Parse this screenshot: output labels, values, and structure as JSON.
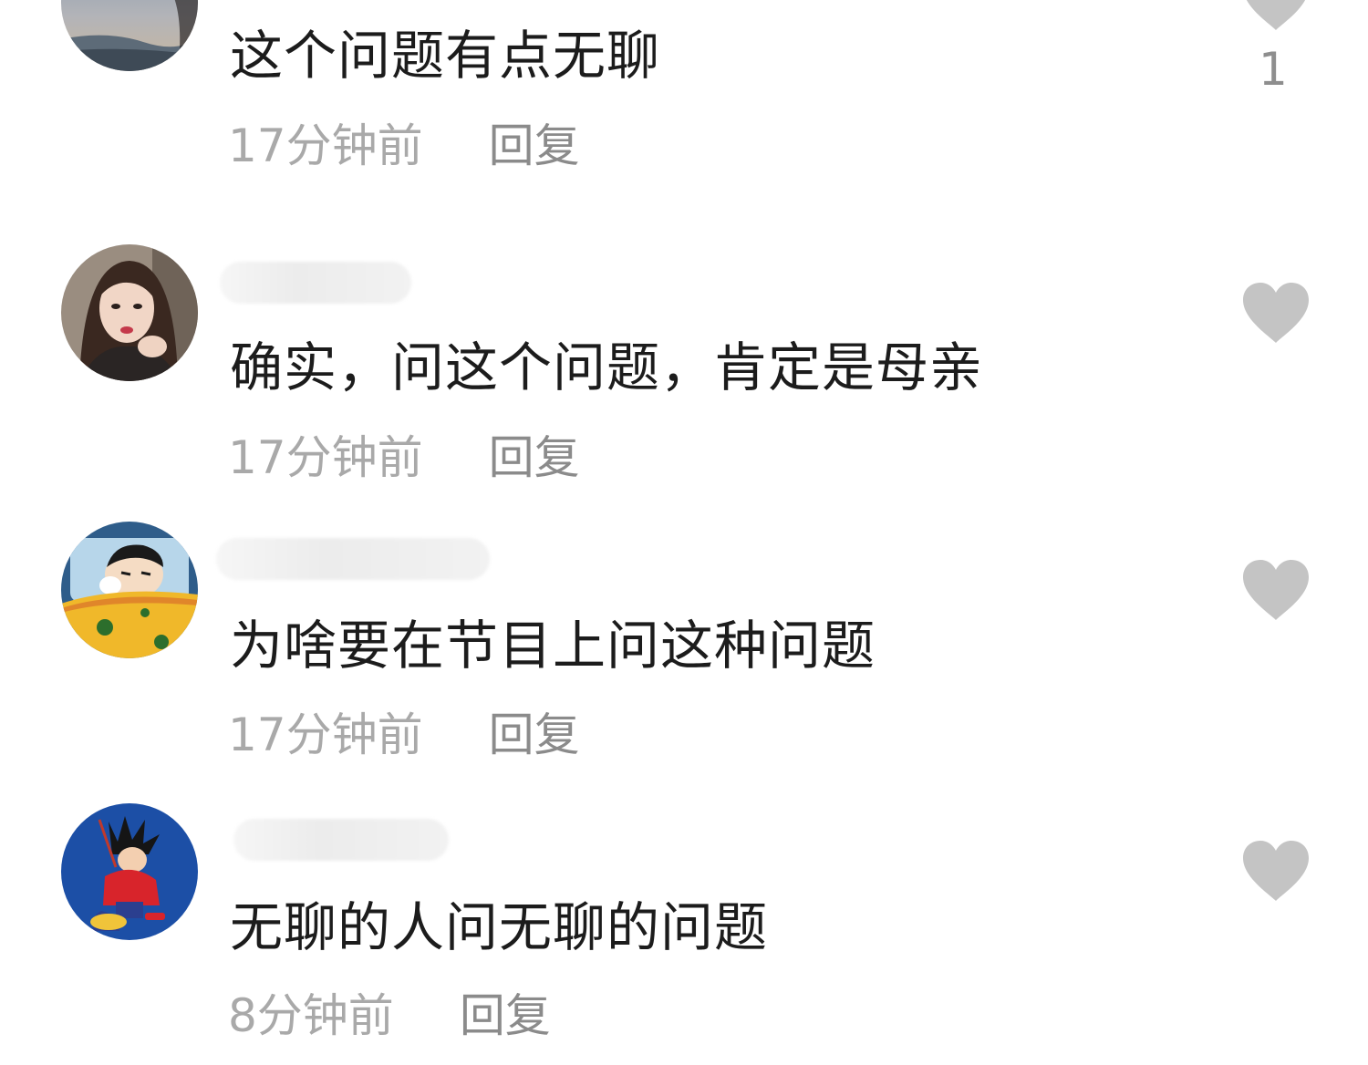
{
  "colors": {
    "text": "#1c1c1c",
    "time": "#a9a9a9",
    "reply": "#8b8b8b",
    "heart": "#c4c4c4"
  },
  "comments": [
    {
      "avatar_icon": "avatar-landscape-photo",
      "username": "",
      "text": "这个问题有点无聊",
      "time": "17分钟前",
      "reply_label": "回复",
      "like_icon": "heart-icon",
      "like_count": "1"
    },
    {
      "avatar_icon": "avatar-woman-photo",
      "username": "",
      "text": "确实，问这个问题，肯定是母亲",
      "time": "17分钟前",
      "reply_label": "回复",
      "like_icon": "heart-icon",
      "like_count": ""
    },
    {
      "avatar_icon": "avatar-cartoon-boy",
      "username": "",
      "text": "为啥要在节目上问这种问题",
      "time": "17分钟前",
      "reply_label": "回复",
      "like_icon": "heart-icon",
      "like_count": ""
    },
    {
      "avatar_icon": "avatar-anime-character",
      "username": "",
      "text": "无聊的人问无聊的问题",
      "time": "8分钟前",
      "reply_label": "回复",
      "like_icon": "heart-icon",
      "like_count": ""
    }
  ]
}
